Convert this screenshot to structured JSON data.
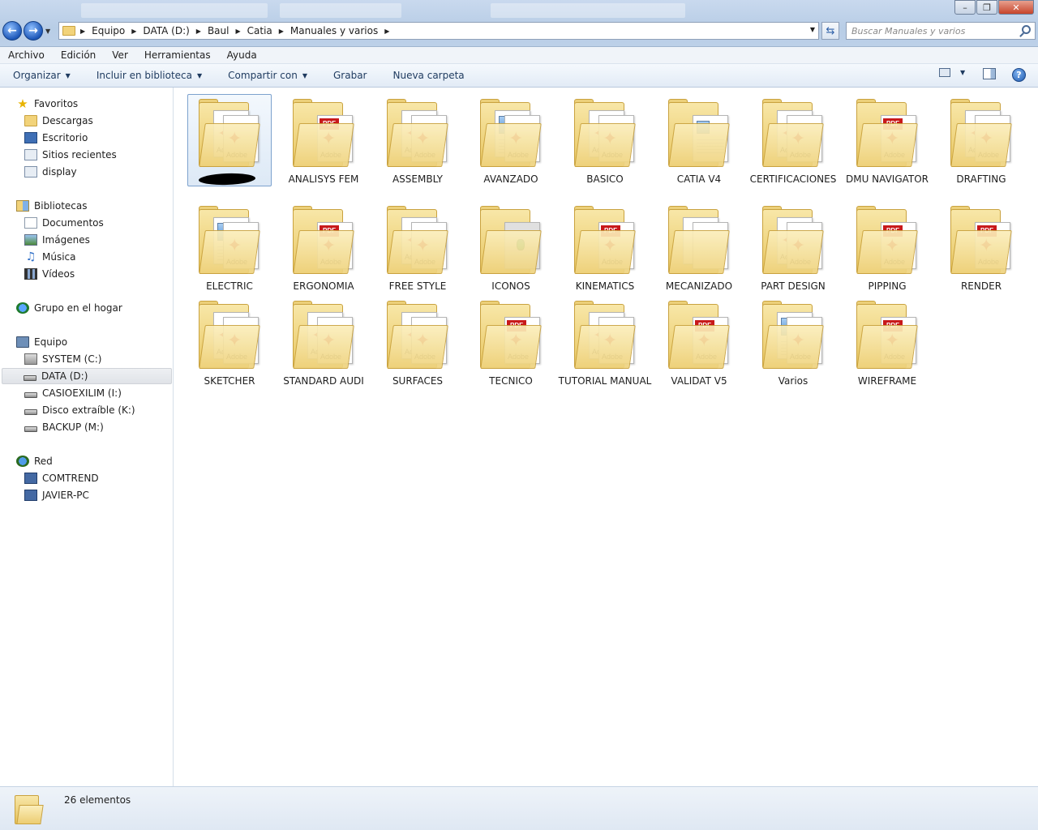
{
  "address": {
    "crumbs": [
      "Equipo",
      "DATA (D:)",
      "Baul",
      "Catia",
      "Manuales y varios"
    ],
    "search_placeholder": "Buscar Manuales y varios"
  },
  "menu": [
    "Archivo",
    "Edición",
    "Ver",
    "Herramientas",
    "Ayuda"
  ],
  "commands": {
    "organizar": "Organizar",
    "incluir": "Incluir en biblioteca",
    "compartir": "Compartir con",
    "grabar": "Grabar",
    "nueva_carpeta": "Nueva carpeta"
  },
  "nav": {
    "favoritos": "Favoritos",
    "descargas": "Descargas",
    "escritorio": "Escritorio",
    "sitios": "Sitios recientes",
    "display": "display",
    "bibliotecas": "Bibliotecas",
    "documentos": "Documentos",
    "imagenes": "Imágenes",
    "musica": "Música",
    "videos": "Vídeos",
    "grupo": "Grupo en el hogar",
    "equipo": "Equipo",
    "system": "SYSTEM (C:)",
    "data": "DATA (D:)",
    "casio": "CASIOEXILIM (I:)",
    "disco": "Disco extraíble (K:)",
    "backup": "BACKUP (M:)",
    "red": "Red",
    "comtrend": "COMTREND",
    "javier": "JAVIER-PC"
  },
  "folders": [
    {
      "label": "",
      "style": "pdf2"
    },
    {
      "label": "ANALISYS FEM",
      "style": "pdf1"
    },
    {
      "label": "ASSEMBLY",
      "style": "pdf2"
    },
    {
      "label": "AVANZADO",
      "style": "img-pdf"
    },
    {
      "label": "BASICO",
      "style": "pdf2"
    },
    {
      "label": "CATIA V4",
      "style": "doc"
    },
    {
      "label": "CERTIFICACIONES",
      "style": "pdf2"
    },
    {
      "label": "DMU NAVIGATOR",
      "style": "pdf1"
    },
    {
      "label": "DRAFTING",
      "style": "pdf2"
    },
    {
      "label": "ELECTRIC",
      "style": "img-pdf"
    },
    {
      "label": "ERGONOMIA",
      "style": "pdf1"
    },
    {
      "label": "FREE STYLE",
      "style": "pdf2"
    },
    {
      "label": "ICONOS",
      "style": "icon"
    },
    {
      "label": "KINEMATICS",
      "style": "pdf1"
    },
    {
      "label": "MECANIZADO",
      "style": "blank"
    },
    {
      "label": "PART DESIGN",
      "style": "pdf2"
    },
    {
      "label": "PIPPING",
      "style": "pdf1"
    },
    {
      "label": "RENDER",
      "style": "pdf1"
    },
    {
      "label": "SKETCHER",
      "style": "pdf2"
    },
    {
      "label": "STANDARD AUDI",
      "style": "pdf2"
    },
    {
      "label": "SURFACES",
      "style": "pdf2"
    },
    {
      "label": "TECNICO",
      "style": "pdf1"
    },
    {
      "label": "TUTORIAL MANUAL",
      "style": "pdf2"
    },
    {
      "label": "VALIDAT V5",
      "style": "pdf1"
    },
    {
      "label": "Varios",
      "style": "img-pdf"
    },
    {
      "label": "WIREFRAME",
      "style": "pdf1"
    }
  ],
  "status": {
    "count": "26 elementos"
  }
}
